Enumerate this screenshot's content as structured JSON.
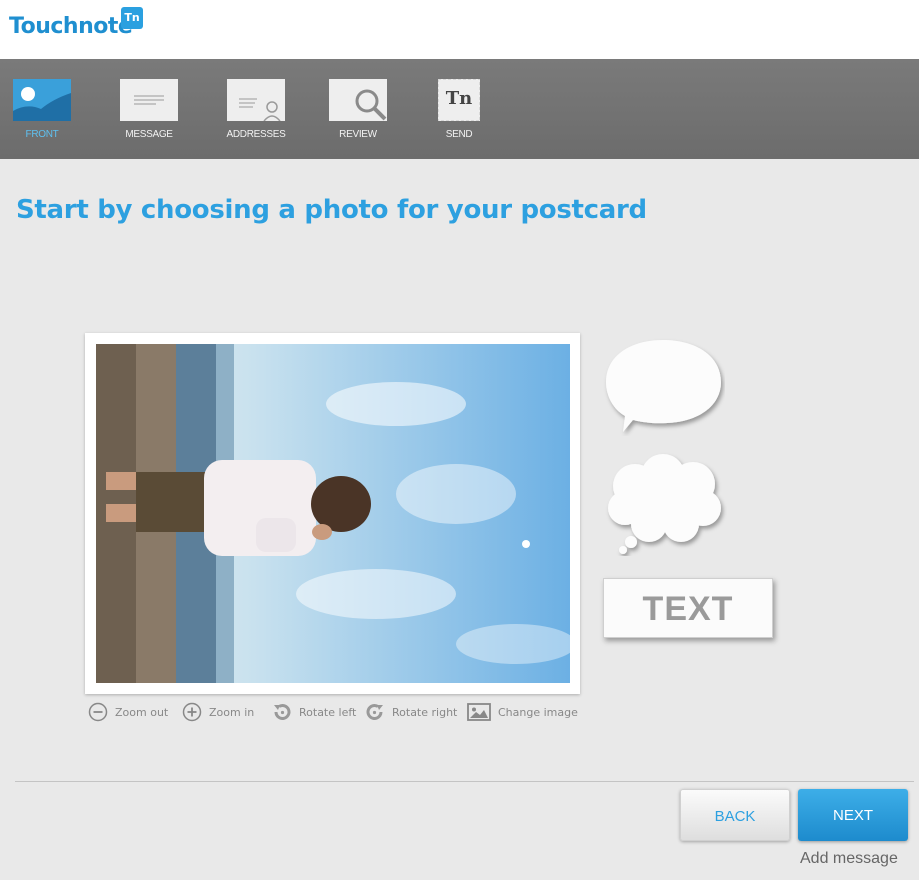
{
  "app": {
    "logo_text": "Touchnote",
    "logo_badge": "Tn"
  },
  "steps": [
    {
      "label": "FRONT",
      "icon": "photo-icon",
      "active": true
    },
    {
      "label": "MESSAGE",
      "icon": "message-icon",
      "active": false
    },
    {
      "label": "ADDRESSES",
      "icon": "addresses-icon",
      "active": false
    },
    {
      "label": "REVIEW",
      "icon": "review-icon",
      "active": false
    },
    {
      "label": "SEND",
      "icon": "stamp-icon",
      "active": false
    }
  ],
  "main": {
    "title": "Start by choosing a photo for your postcard"
  },
  "controls": {
    "zoom_out": "Zoom out",
    "zoom_in": "Zoom in",
    "rotate_left": "Rotate left",
    "rotate_right": "Rotate right",
    "change_image": "Change image"
  },
  "stickers": {
    "text_label": "TEXT"
  },
  "nav": {
    "back": "BACK",
    "next": "NEXT",
    "add_message": "Add message"
  },
  "colors": {
    "accent": "#2da0e0",
    "toolbar": "#717171",
    "background": "#e9e9e9"
  }
}
